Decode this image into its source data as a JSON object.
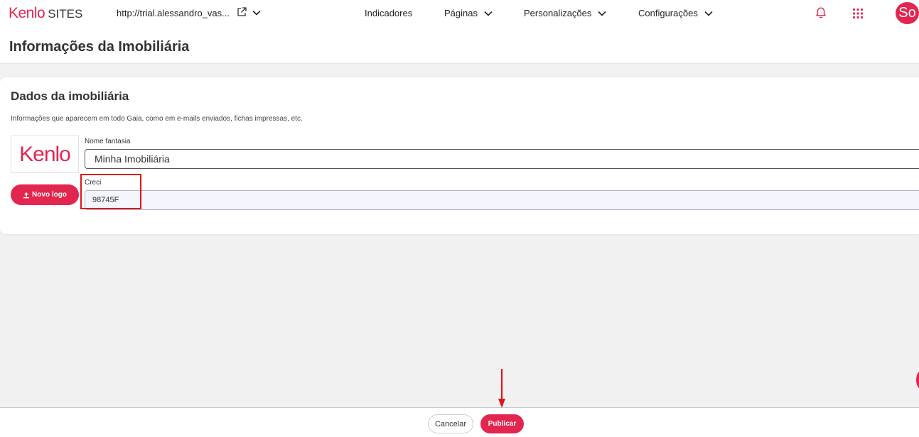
{
  "header": {
    "logo_main": "Kenlo",
    "logo_sub": "SITES",
    "site_url": "http://trial.alessandro_vas...",
    "nav": [
      {
        "label": "Indicadores"
      },
      {
        "label": "Páginas"
      },
      {
        "label": "Personalizações"
      },
      {
        "label": "Configurações"
      }
    ],
    "avatar_initials": "So",
    "icons": {
      "external": "external-link-icon",
      "notifications": "bell-icon",
      "apps": "grid-dots-icon"
    }
  },
  "page": {
    "title": "Informações da Imobiliária"
  },
  "card": {
    "title": "Dados da imobiliária",
    "description": "Informações que aparecem em todo Gaia, como em e-mails enviados, fichas impressas, etc.",
    "logo_preview_text": "Kenlo",
    "upload_button": "Novo logo",
    "fields": {
      "nome_label": "Nome fantasia",
      "nome_value": "Minha Imobiliária",
      "creci_label": "Creci",
      "creci_value": "98745F"
    }
  },
  "footer": {
    "cancel_label": "Cancelar",
    "publish_label": "Publicar"
  },
  "colors": {
    "brand": "#e2264f",
    "annotation": "#e0161b"
  }
}
